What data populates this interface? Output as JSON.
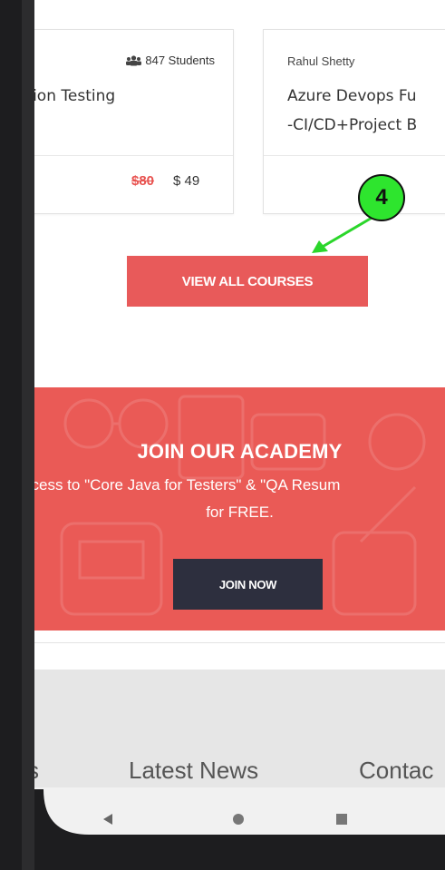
{
  "courses": [
    {
      "students": "847 Students",
      "title": "ation Testing",
      "price_old": "$80",
      "price_new": "$ 49"
    },
    {
      "author": "Rahul Shetty",
      "title_line1": "Azure Devops Fu",
      "title_line2": "-CI/CD+Project B"
    }
  ],
  "view_all_label": "VIEW ALL COURSES",
  "annotation_marker": "4",
  "academy": {
    "title": "JOIN OUR ACADEMY",
    "subtitle_line1": "ccess to \"Core Java for Testers\" & \"QA Resum",
    "subtitle_line2": "for FREE.",
    "join_label": "JOIN NOW"
  },
  "footer": {
    "columns": [
      "s",
      "Latest News",
      "Contac"
    ]
  },
  "colors": {
    "accent": "#e85a5a",
    "dark_button": "#2d2f3e",
    "marker_green": "#2ee52e"
  },
  "nav_icons": [
    "back-icon",
    "home-icon",
    "recents-icon"
  ]
}
